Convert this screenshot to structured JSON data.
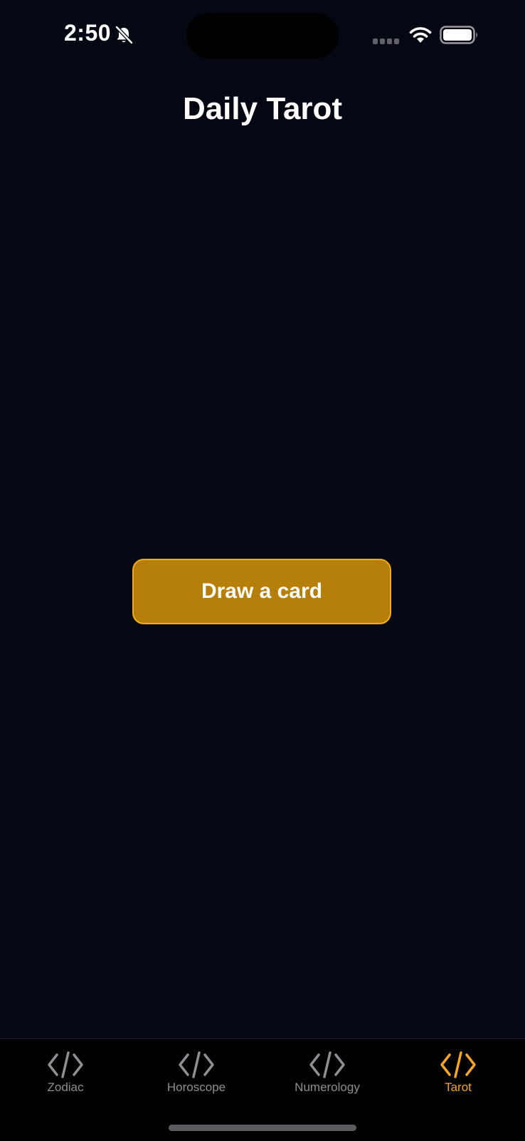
{
  "status_bar": {
    "time": "2:50"
  },
  "header": {
    "title": "Daily Tarot"
  },
  "main": {
    "draw_button_label": "Draw a card"
  },
  "tab_bar": {
    "tabs": [
      {
        "label": "Zodiac",
        "icon": "code-icon",
        "active": false
      },
      {
        "label": "Horoscope",
        "icon": "code-icon",
        "active": false
      },
      {
        "label": "Numerology",
        "icon": "code-icon",
        "active": false
      },
      {
        "label": "Tarot",
        "icon": "code-icon",
        "active": true
      }
    ]
  },
  "colors": {
    "background": "#050812",
    "accent": "#f5a623",
    "button_fill": "#b57f0a",
    "inactive_tab": "#8e8e93"
  }
}
